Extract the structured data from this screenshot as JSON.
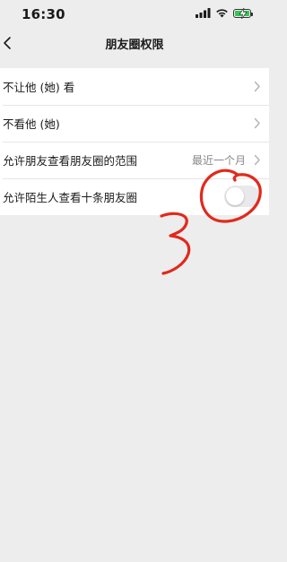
{
  "status_bar": {
    "time": "16:30",
    "icons": [
      "signal-icon",
      "wifi-icon",
      "battery-charging-icon"
    ]
  },
  "nav": {
    "title": "朋友圈权限",
    "back_icon": "chevron-left-icon"
  },
  "settings": {
    "rows": [
      {
        "label": "不让他 (她) 看",
        "type": "link"
      },
      {
        "label": "不看他 (她)",
        "type": "link"
      },
      {
        "label": "允许朋友查看朋友圈的范围",
        "value": "最近一个月",
        "type": "link"
      },
      {
        "label": "允许陌生人查看十条朋友圈",
        "type": "toggle",
        "on": false
      }
    ]
  },
  "annotation": {
    "text": "3",
    "color": "#e02a1c"
  },
  "colors": {
    "background": "#ededed",
    "row_background": "#ffffff",
    "secondary_text": "#888888",
    "battery": "#34c759",
    "toggle_off": "#e9e9eb"
  }
}
